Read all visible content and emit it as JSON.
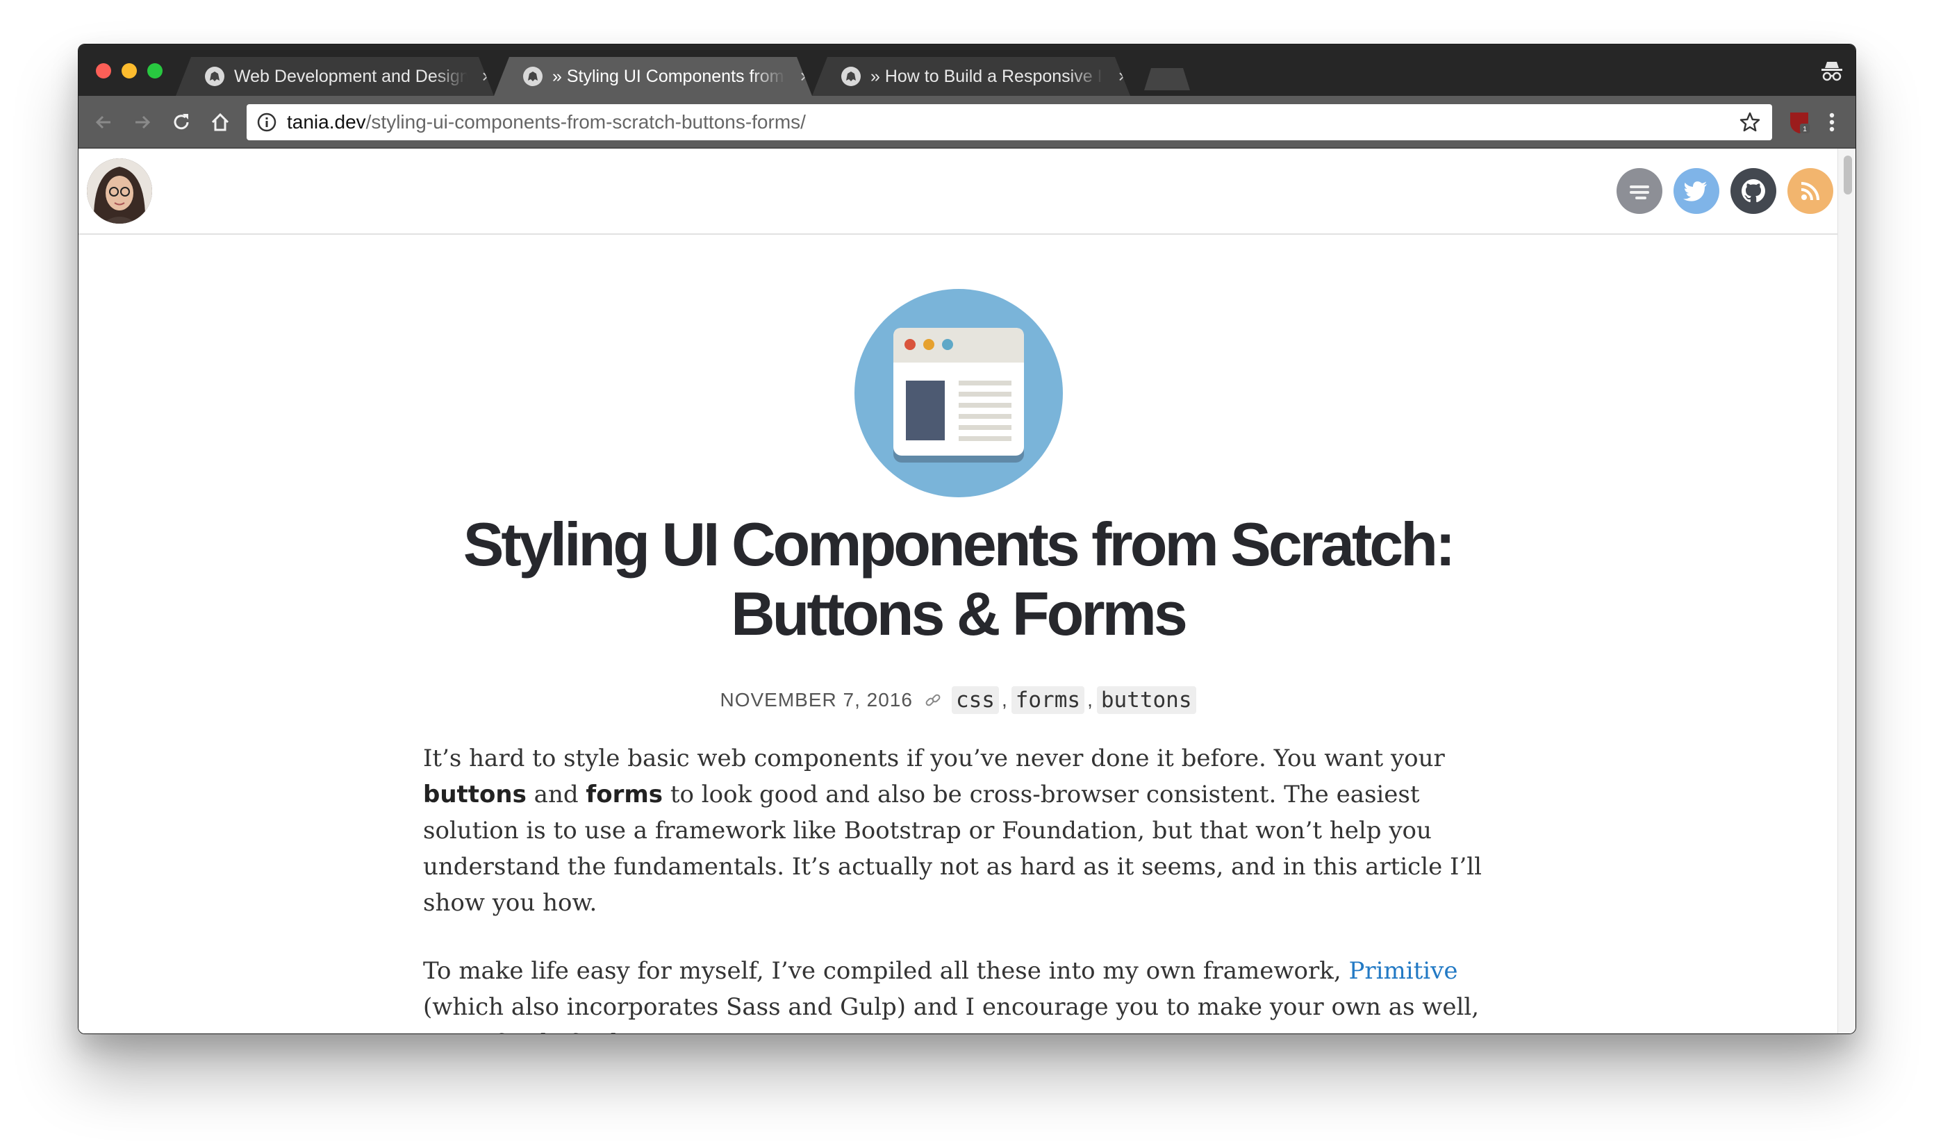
{
  "browser": {
    "tabs": [
      {
        "title": "Web Development and Design",
        "active": false
      },
      {
        "title": "» Styling UI Components from Scratch: Buttons & Forms",
        "active": true
      },
      {
        "title": "» How to Build a Responsive Image Gallery",
        "active": false
      }
    ],
    "tab_close_glyph": "×",
    "url_host": "tania.dev",
    "url_path": "/styling-ui-components-from-scratch-buttons-forms/",
    "icons": [
      "back-icon",
      "forward-icon",
      "reload-icon",
      "home-icon",
      "info-icon",
      "star-icon",
      "extension-icon",
      "menu-icon",
      "incognito-icon"
    ]
  },
  "site": {
    "social_links": [
      "menu-icon",
      "twitter-icon",
      "github-icon",
      "rss-icon"
    ],
    "colors": {
      "twitter": "#7fb4e8",
      "github": "#434850",
      "rss": "#f2b56e",
      "menu": "#8d8f96"
    }
  },
  "post": {
    "title_line1": "Styling UI Components from Scratch:",
    "title_line2": "Buttons & Forms",
    "date": "NOVEMBER 7, 2016",
    "tags": [
      "css",
      "forms",
      "buttons"
    ],
    "tag_separator": ",",
    "p1": {
      "a": "It’s hard to style basic web components if you’ve never done it before. You want your ",
      "b": "buttons",
      "c": " and ",
      "d": "forms",
      "e": " to look good and also be cross-browser consistent. The easiest solution is to use a framework like Bootstrap or Foundation, but that won’t help you understand the fundamentals. It’s actually not as hard as it seems, and in this article I’ll show you how."
    },
    "p2": {
      "a": "To make life easy for myself, I’ve compiled all these into my own framework, ",
      "link": "Primitive",
      "b": " (which also incorporates Sass and Gulp) and I encourage you to make your own as well, even if only for learning purposes."
    },
    "link_color": "#2279c4"
  }
}
